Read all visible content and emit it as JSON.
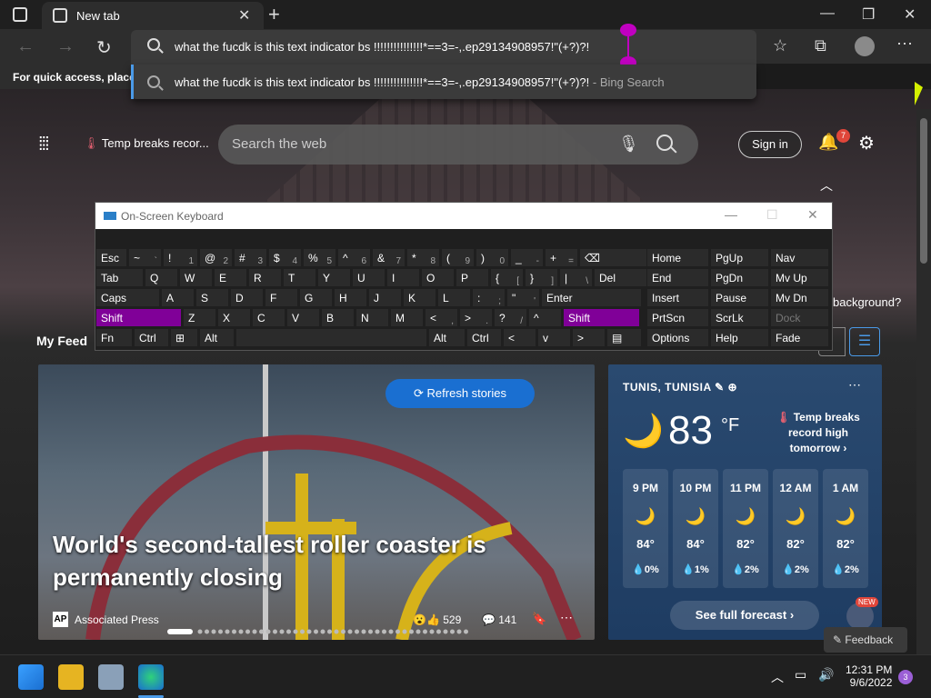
{
  "browser": {
    "tab_title": "New tab",
    "address_text": "what the fucdk is this text indicator bs !!!!!!!!!!!!!!!*==3=-,.ep29134908957!\"(+?)?!",
    "suggestion_query": "what the fucdk is this text indicator bs !!!!!!!!!!!!!!!*==3=-,.ep29134908957!\"(+?)?!",
    "suggestion_suffix": " - Bing Search",
    "favorites_hint": "For quick access, place y"
  },
  "newtab": {
    "temp_link": "Temp breaks recor...",
    "search_placeholder": "Search the web",
    "signin_label": "Sign in",
    "notification_count": "7",
    "background_question": "background?",
    "my_feed": "My Feed"
  },
  "osk": {
    "title": "On-Screen Keyboard",
    "rows": [
      [
        {
          "label": "Esc"
        },
        {
          "label": "~",
          "sub": "`"
        },
        {
          "label": "!",
          "sub": "1"
        },
        {
          "label": "@",
          "sub": "2"
        },
        {
          "label": "#",
          "sub": "3"
        },
        {
          "label": "$",
          "sub": "4"
        },
        {
          "label": "%",
          "sub": "5"
        },
        {
          "label": "^",
          "sub": "6"
        },
        {
          "label": "&",
          "sub": "7"
        },
        {
          "label": "*",
          "sub": "8"
        },
        {
          "label": "(",
          "sub": "9"
        },
        {
          "label": ")",
          "sub": "0"
        },
        {
          "label": "_",
          "sub": "-"
        },
        {
          "label": "+",
          "sub": "="
        },
        {
          "label": "⌫"
        },
        {
          "label": "Home"
        },
        {
          "label": "PgUp"
        },
        {
          "label": "Nav"
        }
      ],
      [
        {
          "label": "Tab"
        },
        {
          "label": "Q"
        },
        {
          "label": "W"
        },
        {
          "label": "E"
        },
        {
          "label": "R"
        },
        {
          "label": "T"
        },
        {
          "label": "Y"
        },
        {
          "label": "U"
        },
        {
          "label": "I"
        },
        {
          "label": "O"
        },
        {
          "label": "P"
        },
        {
          "label": "{",
          "sub": "["
        },
        {
          "label": "}",
          "sub": "]"
        },
        {
          "label": "|",
          "sub": "\\"
        },
        {
          "label": "Del"
        },
        {
          "label": "End"
        },
        {
          "label": "PgDn"
        },
        {
          "label": "Mv Up"
        }
      ],
      [
        {
          "label": "Caps"
        },
        {
          "label": "A"
        },
        {
          "label": "S"
        },
        {
          "label": "D"
        },
        {
          "label": "F"
        },
        {
          "label": "G"
        },
        {
          "label": "H"
        },
        {
          "label": "J"
        },
        {
          "label": "K"
        },
        {
          "label": "L"
        },
        {
          "label": ":",
          "sub": ";"
        },
        {
          "label": "\"",
          "sub": "'"
        },
        {
          "label": "Enter"
        },
        {
          "label": "Insert"
        },
        {
          "label": "Pause"
        },
        {
          "label": "Mv Dn"
        }
      ],
      [
        {
          "label": "Shift",
          "on": true
        },
        {
          "label": "Z"
        },
        {
          "label": "X"
        },
        {
          "label": "C"
        },
        {
          "label": "V"
        },
        {
          "label": "B"
        },
        {
          "label": "N"
        },
        {
          "label": "M"
        },
        {
          "label": "<",
          "sub": ","
        },
        {
          "label": ">",
          "sub": "."
        },
        {
          "label": "?",
          "sub": "/"
        },
        {
          "label": "^"
        },
        {
          "label": "Shift",
          "on": true
        },
        {
          "label": "PrtScn"
        },
        {
          "label": "ScrLk"
        },
        {
          "label": "Dock",
          "dim": true
        }
      ],
      [
        {
          "label": "Fn"
        },
        {
          "label": "Ctrl"
        },
        {
          "label": "⊞"
        },
        {
          "label": "Alt"
        },
        {
          "label": ""
        },
        {
          "label": "Alt"
        },
        {
          "label": "Ctrl"
        },
        {
          "label": "<"
        },
        {
          "label": "v"
        },
        {
          "label": ">"
        },
        {
          "label": "▤"
        },
        {
          "label": "Options"
        },
        {
          "label": "Help"
        },
        {
          "label": "Fade"
        }
      ]
    ]
  },
  "hero": {
    "refresh_label": "Refresh stories",
    "headline": "World's second-tallest roller coaster is permanently closing",
    "source": "Associated Press",
    "source_logo": "AP",
    "reactions": "529",
    "comments": "141"
  },
  "weather": {
    "location": "TUNIS, TUNISIA",
    "temp": "83",
    "unit": "°F",
    "alert": "Temp breaks record high tomorrow",
    "hours": [
      {
        "time": "9 PM",
        "temp": "84°",
        "precip": "0%"
      },
      {
        "time": "10 PM",
        "temp": "84°",
        "precip": "1%"
      },
      {
        "time": "11 PM",
        "temp": "82°",
        "precip": "2%"
      },
      {
        "time": "12 AM",
        "temp": "82°",
        "precip": "2%"
      },
      {
        "time": "1 AM",
        "temp": "82°",
        "precip": "2%"
      }
    ],
    "forecast_label": "See full forecast",
    "new_badge": "NEW"
  },
  "feedback_label": "Feedback",
  "taskbar": {
    "time": "12:31 PM",
    "date": "9/6/2022",
    "notifications": "3"
  },
  "colors": {
    "accent": "#1a6fd1",
    "osk_active": "#800098",
    "caret": "#c000c0"
  }
}
